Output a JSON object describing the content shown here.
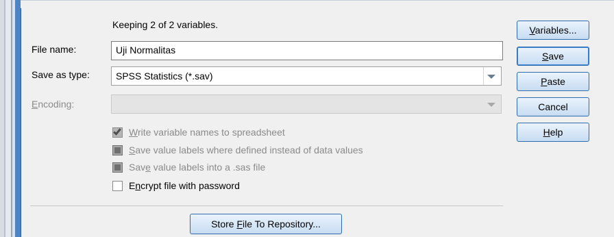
{
  "info_text": "Keeping 2 of 2 variables.",
  "file_name": {
    "label": "File name:",
    "value": "Uji Normalitas"
  },
  "save_as_type": {
    "label": "Save as type:",
    "value": "SPSS Statistics (*.sav)"
  },
  "encoding": {
    "label": "Encoding:",
    "value": ""
  },
  "options": [
    {
      "label": "Write variable names to spreadsheet",
      "checked": true,
      "enabled": false
    },
    {
      "label": "Save value labels where defined instead of data values",
      "checked": false,
      "enabled": false
    },
    {
      "label": "Save value labels into a .sas file",
      "checked": false,
      "enabled": false
    },
    {
      "label": "Encrypt file with password",
      "checked": false,
      "enabled": true
    }
  ],
  "buttons": {
    "variables": "Variables...",
    "save": "Save",
    "paste": "Paste",
    "cancel": "Cancel",
    "help": "Help",
    "store": "Store File To Repository..."
  },
  "colors": {
    "frame_blue": "#4f84c4",
    "panel_bg": "#f0f0f0",
    "button_border": "#2f6cad"
  },
  "icons": {
    "dropdown": "chevron-down-icon",
    "checkbox_checked": "check-icon"
  }
}
